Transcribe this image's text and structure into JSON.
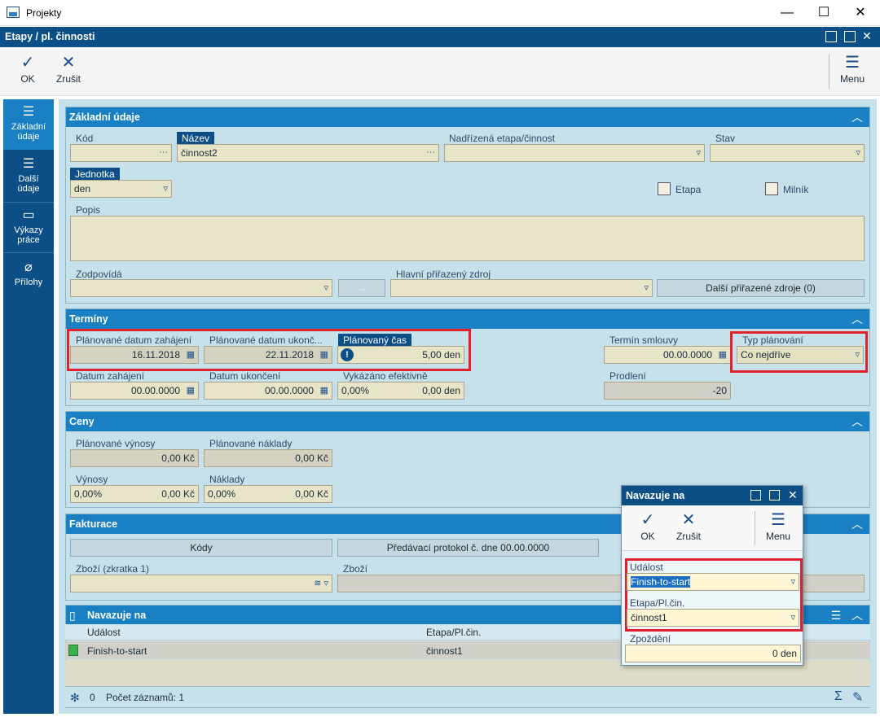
{
  "window": {
    "title": "Projekty",
    "minimize": "—",
    "maximize": "☐",
    "close": "✕"
  },
  "subwindow": {
    "title": "Etapy / pl. činnosti"
  },
  "toolbar": {
    "ok": "OK",
    "cancel": "Zrušit",
    "menu": "Menu"
  },
  "nav": [
    {
      "label_1": "Základní",
      "label_2": "údaje",
      "icon": "list-icon"
    },
    {
      "label_1": "Další",
      "label_2": "údaje",
      "icon": "list-icon"
    },
    {
      "label_1": "Výkazy",
      "label_2": "práce",
      "icon": "archive-icon"
    },
    {
      "label_1": "Přílohy",
      "label_2": "",
      "icon": "paperclip-icon"
    }
  ],
  "basic": {
    "title": "Základní údaje",
    "kod_label": "Kód",
    "kod_value": "",
    "nazev_label": "Název",
    "nazev_value": "činnost2",
    "parent_label": "Nadřízená etapa/činnost",
    "parent_value": "",
    "stav_label": "Stav",
    "stav_value": "",
    "jednotka_label": "Jednotka",
    "jednotka_value": "den",
    "etapa_label": "Etapa",
    "milnik_label": "Milník",
    "popis_label": "Popis",
    "popis_value": "",
    "zodpovida_label": "Zodpovídá",
    "zodpovida_value": "",
    "zdroj_label": "Hlavní přiřazený zdroj",
    "zdroj_value": "",
    "dalsi_zdroje": "Další přiřazené zdroje (0)"
  },
  "terms": {
    "title": "Termíny",
    "plan_start_label": "Plánované datum zahájení",
    "plan_start": "16.11.2018",
    "plan_end_label": "Plánované datum ukonč...",
    "plan_end": "22.11.2018",
    "plan_time_label": "Plánovaný čas",
    "plan_time": "5,00 den",
    "start_label": "Datum zahájení",
    "start": "00.00.0000",
    "end_label": "Datum ukončení",
    "end": "00.00.0000",
    "effective_label": "Vykázáno efektivně",
    "effective_pct": "0,00%",
    "effective": "0,00 den",
    "contract_label": "Termín smlouvy",
    "contract": "00.00.0000",
    "delay_label": "Prodlení",
    "delay": "-20",
    "plan_type_label": "Typ plánování",
    "plan_type": "Co nejdříve"
  },
  "prices": {
    "title": "Ceny",
    "plan_rev_label": "Plánované výnosy",
    "plan_rev": "0,00 Kč",
    "plan_cost_label": "Plánované náklady",
    "plan_cost": "0,00 Kč",
    "rev_label": "Výnosy",
    "rev_pct": "0,00%",
    "rev": "0,00 Kč",
    "cost_label": "Náklady",
    "cost_pct": "0,00%",
    "cost": "0,00 Kč"
  },
  "invoice": {
    "title": "Fakturace",
    "codes": "Kódy",
    "protocol": "Předávací protokol č.  dne 00.00.0000",
    "goods_short_label": "Zboží (zkratka 1)",
    "goods_label": "Zboží"
  },
  "links": {
    "title": "Navazuje na",
    "col_event": "Událost",
    "col_stage": "Etapa/Pl.čin.",
    "rows": [
      {
        "event": "Finish-to-start",
        "stage": "činnost1"
      }
    ],
    "count_value": "0",
    "count_label": "Počet záznamů: 1"
  },
  "popup": {
    "title": "Navazuje na",
    "ok": "OK",
    "cancel": "Zrušit",
    "menu": "Menu",
    "event_label": "Událost",
    "event_value": "Finish-to-start",
    "stage_label": "Etapa/Pl.čin.",
    "stage_value": "činnost1",
    "delay_label": "Zpoždění",
    "delay_value": "0 den"
  }
}
